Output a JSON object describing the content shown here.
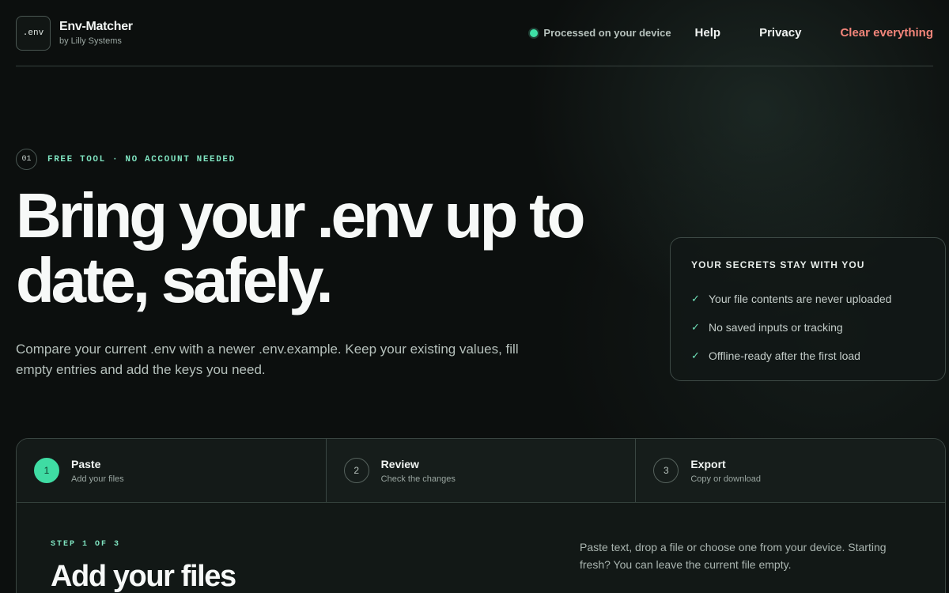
{
  "header": {
    "logo_text": ".env",
    "app_name": "Env-Matcher",
    "app_byline": "by Lilly Systems",
    "status": "Processed on your device",
    "nav": {
      "help": "Help",
      "privacy": "Privacy",
      "clear": "Clear everything"
    }
  },
  "hero": {
    "badge_number": "01",
    "badge_text": "FREE TOOL · NO ACCOUNT NEEDED",
    "title": "Bring your .env up to date, safely.",
    "description": "Compare your current .env with a newer .env.example. Keep your existing values, fill empty entries and add the keys you need."
  },
  "secrets": {
    "title": "YOUR SECRETS STAY WITH YOU",
    "items": [
      "Your file contents are never uploaded",
      "No saved inputs or tracking",
      "Offline-ready after the first load"
    ]
  },
  "steps": [
    {
      "number": "1",
      "label": "Paste",
      "sub": "Add your files",
      "active": true
    },
    {
      "number": "2",
      "label": "Review",
      "sub": "Check the changes",
      "active": false
    },
    {
      "number": "3",
      "label": "Export",
      "sub": "Copy or download",
      "active": false
    }
  ],
  "current_step": {
    "kicker": "STEP 1 OF 3",
    "title": "Add your files",
    "hint": "Paste text, drop a file or choose one from your device. Starting fresh? You can leave the current file empty."
  },
  "colors": {
    "accent": "#3fdca3",
    "danger": "#f2857a",
    "background": "#0c0f0e"
  }
}
